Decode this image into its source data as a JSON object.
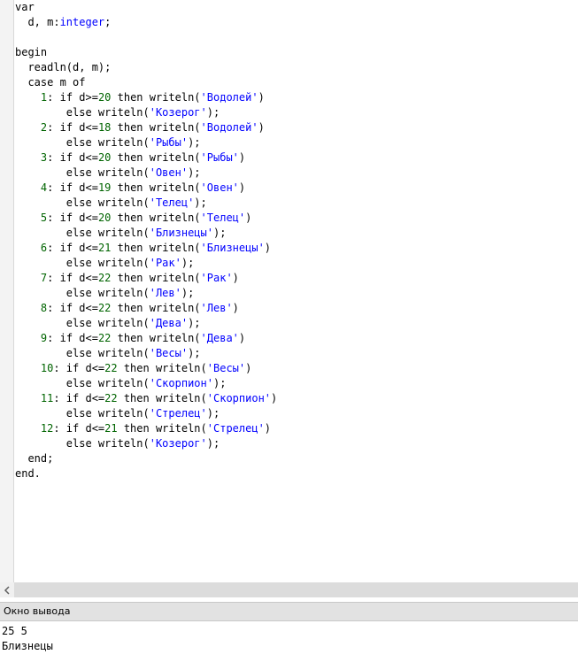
{
  "editor": {
    "lines": [
      [
        {
          "t": "var",
          "c": "kw"
        }
      ],
      [
        {
          "t": "  d, m:",
          "c": "plain"
        },
        {
          "t": "integer",
          "c": "type"
        },
        {
          "t": ";",
          "c": "plain"
        }
      ],
      [
        {
          "t": "",
          "c": "plain"
        }
      ],
      [
        {
          "t": "begin",
          "c": "kw"
        }
      ],
      [
        {
          "t": "  readln(d, m);",
          "c": "plain"
        }
      ],
      [
        {
          "t": "  case m of",
          "c": "kw"
        }
      ],
      [
        {
          "t": "    ",
          "c": "plain"
        },
        {
          "t": "1",
          "c": "num"
        },
        {
          "t": ": if d>=",
          "c": "plain"
        },
        {
          "t": "20",
          "c": "num"
        },
        {
          "t": " then writeln(",
          "c": "plain"
        },
        {
          "t": "'Водолей'",
          "c": "str"
        },
        {
          "t": ")",
          "c": "plain"
        }
      ],
      [
        {
          "t": "        else writeln(",
          "c": "plain"
        },
        {
          "t": "'Козерог'",
          "c": "str"
        },
        {
          "t": ");",
          "c": "plain"
        }
      ],
      [
        {
          "t": "    ",
          "c": "plain"
        },
        {
          "t": "2",
          "c": "num"
        },
        {
          "t": ": if d<=",
          "c": "plain"
        },
        {
          "t": "18",
          "c": "num"
        },
        {
          "t": " then writeln(",
          "c": "plain"
        },
        {
          "t": "'Водолей'",
          "c": "str"
        },
        {
          "t": ")",
          "c": "plain"
        }
      ],
      [
        {
          "t": "        else writeln(",
          "c": "plain"
        },
        {
          "t": "'Рыбы'",
          "c": "str"
        },
        {
          "t": ");",
          "c": "plain"
        }
      ],
      [
        {
          "t": "    ",
          "c": "plain"
        },
        {
          "t": "3",
          "c": "num"
        },
        {
          "t": ": if d<=",
          "c": "plain"
        },
        {
          "t": "20",
          "c": "num"
        },
        {
          "t": " then writeln(",
          "c": "plain"
        },
        {
          "t": "'Рыбы'",
          "c": "str"
        },
        {
          "t": ")",
          "c": "plain"
        }
      ],
      [
        {
          "t": "        else writeln(",
          "c": "plain"
        },
        {
          "t": "'Овен'",
          "c": "str"
        },
        {
          "t": ");",
          "c": "plain"
        }
      ],
      [
        {
          "t": "    ",
          "c": "plain"
        },
        {
          "t": "4",
          "c": "num"
        },
        {
          "t": ": if d<=",
          "c": "plain"
        },
        {
          "t": "19",
          "c": "num"
        },
        {
          "t": " then writeln(",
          "c": "plain"
        },
        {
          "t": "'Овен'",
          "c": "str"
        },
        {
          "t": ")",
          "c": "plain"
        }
      ],
      [
        {
          "t": "        else writeln(",
          "c": "plain"
        },
        {
          "t": "'Телец'",
          "c": "str"
        },
        {
          "t": ");",
          "c": "plain"
        }
      ],
      [
        {
          "t": "    ",
          "c": "plain"
        },
        {
          "t": "5",
          "c": "num"
        },
        {
          "t": ": if d<=",
          "c": "plain"
        },
        {
          "t": "20",
          "c": "num"
        },
        {
          "t": " then writeln(",
          "c": "plain"
        },
        {
          "t": "'Телец'",
          "c": "str"
        },
        {
          "t": ")",
          "c": "plain"
        }
      ],
      [
        {
          "t": "        else writeln(",
          "c": "plain"
        },
        {
          "t": "'Близнецы'",
          "c": "str"
        },
        {
          "t": ");",
          "c": "plain"
        }
      ],
      [
        {
          "t": "    ",
          "c": "plain"
        },
        {
          "t": "6",
          "c": "num"
        },
        {
          "t": ": if d<=",
          "c": "plain"
        },
        {
          "t": "21",
          "c": "num"
        },
        {
          "t": " then writeln(",
          "c": "plain"
        },
        {
          "t": "'Близнецы'",
          "c": "str"
        },
        {
          "t": ")",
          "c": "plain"
        }
      ],
      [
        {
          "t": "        else writeln(",
          "c": "plain"
        },
        {
          "t": "'Рак'",
          "c": "str"
        },
        {
          "t": ");",
          "c": "plain"
        }
      ],
      [
        {
          "t": "    ",
          "c": "plain"
        },
        {
          "t": "7",
          "c": "num"
        },
        {
          "t": ": if d<=",
          "c": "plain"
        },
        {
          "t": "22",
          "c": "num"
        },
        {
          "t": " then writeln(",
          "c": "plain"
        },
        {
          "t": "'Рак'",
          "c": "str"
        },
        {
          "t": ")",
          "c": "plain"
        }
      ],
      [
        {
          "t": "        else writeln(",
          "c": "plain"
        },
        {
          "t": "'Лев'",
          "c": "str"
        },
        {
          "t": ");",
          "c": "plain"
        }
      ],
      [
        {
          "t": "    ",
          "c": "plain"
        },
        {
          "t": "8",
          "c": "num"
        },
        {
          "t": ": if d<=",
          "c": "plain"
        },
        {
          "t": "22",
          "c": "num"
        },
        {
          "t": " then writeln(",
          "c": "plain"
        },
        {
          "t": "'Лев'",
          "c": "str"
        },
        {
          "t": ")",
          "c": "plain"
        }
      ],
      [
        {
          "t": "        else writeln(",
          "c": "plain"
        },
        {
          "t": "'Дева'",
          "c": "str"
        },
        {
          "t": ");",
          "c": "plain"
        }
      ],
      [
        {
          "t": "    ",
          "c": "plain"
        },
        {
          "t": "9",
          "c": "num"
        },
        {
          "t": ": if d<=",
          "c": "plain"
        },
        {
          "t": "22",
          "c": "num"
        },
        {
          "t": " then writeln(",
          "c": "plain"
        },
        {
          "t": "'Дева'",
          "c": "str"
        },
        {
          "t": ")",
          "c": "plain"
        }
      ],
      [
        {
          "t": "        else writeln(",
          "c": "plain"
        },
        {
          "t": "'Весы'",
          "c": "str"
        },
        {
          "t": ");",
          "c": "plain"
        }
      ],
      [
        {
          "t": "    ",
          "c": "plain"
        },
        {
          "t": "10",
          "c": "num"
        },
        {
          "t": ": if d<=",
          "c": "plain"
        },
        {
          "t": "22",
          "c": "num"
        },
        {
          "t": " then writeln(",
          "c": "plain"
        },
        {
          "t": "'Весы'",
          "c": "str"
        },
        {
          "t": ")",
          "c": "plain"
        }
      ],
      [
        {
          "t": "        else writeln(",
          "c": "plain"
        },
        {
          "t": "'Скорпион'",
          "c": "str"
        },
        {
          "t": ");",
          "c": "plain"
        }
      ],
      [
        {
          "t": "    ",
          "c": "plain"
        },
        {
          "t": "11",
          "c": "num"
        },
        {
          "t": ": if d<=",
          "c": "plain"
        },
        {
          "t": "22",
          "c": "num"
        },
        {
          "t": " then writeln(",
          "c": "plain"
        },
        {
          "t": "'Скорпион'",
          "c": "str"
        },
        {
          "t": ")",
          "c": "plain"
        }
      ],
      [
        {
          "t": "        else writeln(",
          "c": "plain"
        },
        {
          "t": "'Стрелец'",
          "c": "str"
        },
        {
          "t": ");",
          "c": "plain"
        }
      ],
      [
        {
          "t": "    ",
          "c": "plain"
        },
        {
          "t": "12",
          "c": "num"
        },
        {
          "t": ": if d<=",
          "c": "plain"
        },
        {
          "t": "21",
          "c": "num"
        },
        {
          "t": " then writeln(",
          "c": "plain"
        },
        {
          "t": "'Стрелец'",
          "c": "str"
        },
        {
          "t": ")",
          "c": "plain"
        }
      ],
      [
        {
          "t": "        else writeln(",
          "c": "plain"
        },
        {
          "t": "'Козерог'",
          "c": "str"
        },
        {
          "t": ");",
          "c": "plain"
        }
      ],
      [
        {
          "t": "  end;",
          "c": "kw"
        }
      ],
      [
        {
          "t": "end.",
          "c": "kw"
        }
      ]
    ]
  },
  "scrollbar": {
    "left_arrow": "‹"
  },
  "output_panel": {
    "title": "Окно вывода",
    "lines": [
      "25 5",
      "Близнецы"
    ]
  },
  "colors": {
    "keyword": "#000000",
    "type": "#0000ff",
    "number": "#006400",
    "string": "#0000ff"
  }
}
